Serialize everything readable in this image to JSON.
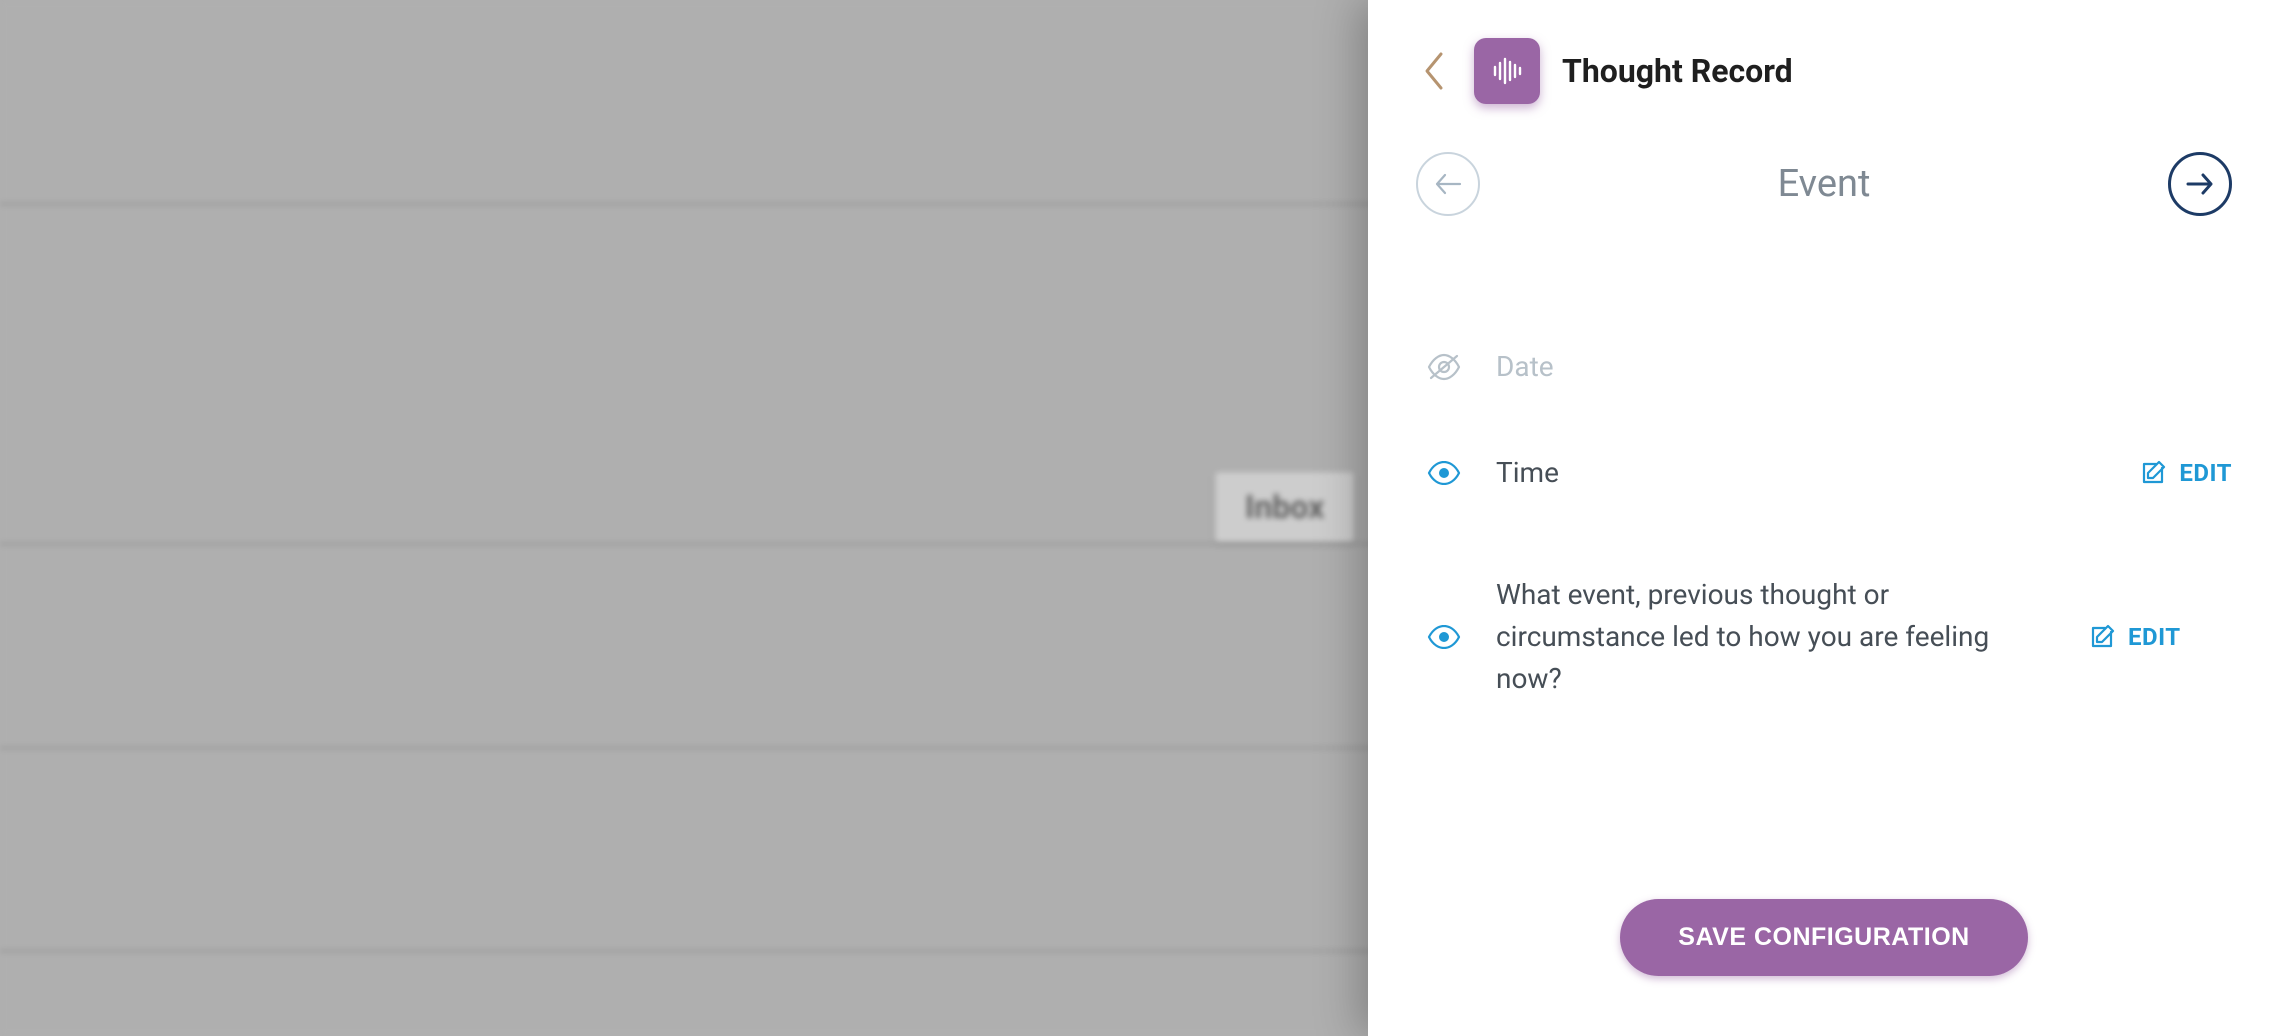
{
  "backdrop": {
    "inbox_label": "Inbox"
  },
  "drawer": {
    "title": "Thought Record",
    "stepper": {
      "title": "Event"
    },
    "fields": [
      {
        "label": "Date",
        "visible": false,
        "editable": false
      },
      {
        "label": "Time",
        "visible": true,
        "editable": true,
        "edit_label": "EDIT"
      },
      {
        "label": "What event, previous thought or circumstance led to how you are feeling now?",
        "visible": true,
        "editable": true,
        "edit_label": "EDIT"
      }
    ],
    "save_label": "SAVE CONFIGURATION"
  },
  "colors": {
    "accent_purple": "#9a66a5",
    "accent_blue": "#1f98d5",
    "nav_dark": "#1d3b66"
  }
}
